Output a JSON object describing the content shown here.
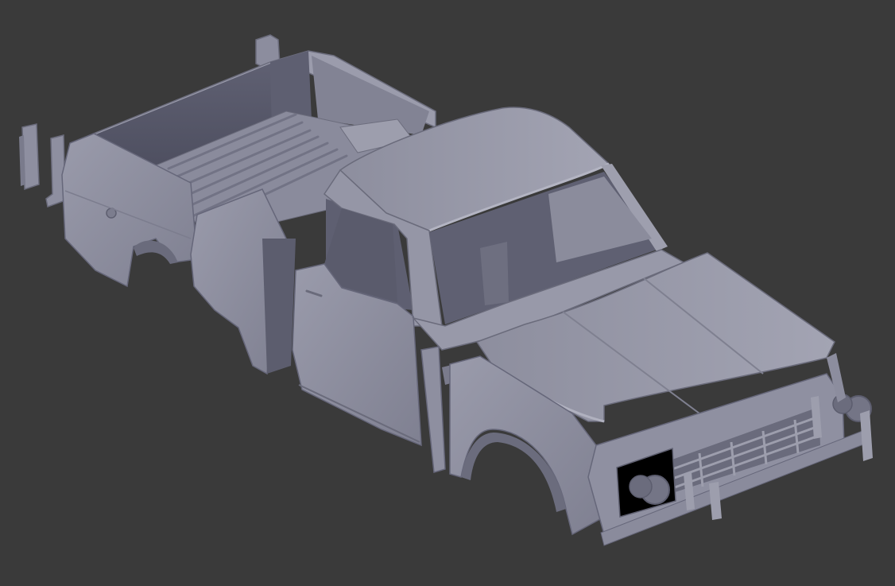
{
  "viewport": {
    "background_color": "#3a3a3a",
    "model_color": "#8a8b9c",
    "model_shadow_color": "#5b5c6c",
    "model_highlight_color": "#a1a2b1"
  }
}
